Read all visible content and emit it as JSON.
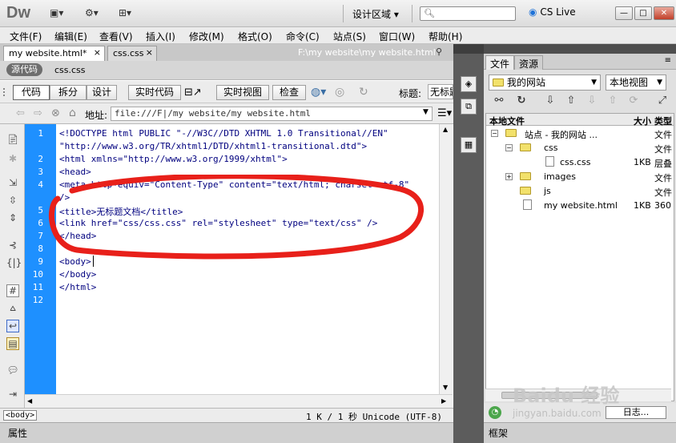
{
  "app": {
    "logo": "Dw",
    "workspace": "设计区域",
    "cslive": "CS Live"
  },
  "window": {
    "minimize": "—",
    "restore": "□",
    "close": "✕"
  },
  "menu": [
    "文件(F)",
    "编辑(E)",
    "查看(V)",
    "插入(I)",
    "修改(M)",
    "格式(O)",
    "命令(C)",
    "站点(S)",
    "窗口(W)",
    "帮助(H)"
  ],
  "tabs": [
    {
      "label": "my website.html*"
    },
    {
      "label": "css.css"
    }
  ],
  "doc_path": "F:\\my website\\my website.html",
  "source_code_label": "源代码",
  "related_file": "css.css",
  "toolbar": {
    "code": "代码",
    "split": "拆分",
    "design": "设计",
    "live_code": "实时代码",
    "live_view": "实时视图",
    "inspect": "检查",
    "title_label": "标题:",
    "title_value": "无标题"
  },
  "address": {
    "label": "地址:",
    "value": "file:///F|/my website/my website.html"
  },
  "code_lines": [
    {
      "num": "1",
      "text": "<!DOCTYPE html PUBLIC \"-//W3C//DTD XHTML 1.0 Transitional//EN\""
    },
    {
      "num": "",
      "text": "\"http://www.w3.org/TR/xhtml1/DTD/xhtml1-transitional.dtd\">"
    },
    {
      "num": "2",
      "text": "<html xmlns=\"http://www.w3.org/1999/xhtml\">"
    },
    {
      "num": "3",
      "text": "<head>"
    },
    {
      "num": "4",
      "text": "<meta http-equiv=\"Content-Type\" content=\"text/html; charset=utf-8\""
    },
    {
      "num": "",
      "text": "/>"
    },
    {
      "num": "5",
      "text": "<title>无标题文档</title>"
    },
    {
      "num": "6",
      "text": "<link href=\"css/css.css\" rel=\"stylesheet\" type=\"text/css\" />"
    },
    {
      "num": "7",
      "text": "</head>"
    },
    {
      "num": "8",
      "text": ""
    },
    {
      "num": "9",
      "text": "<body>"
    },
    {
      "num": "10",
      "text": "</body>"
    },
    {
      "num": "11",
      "text": "</html>"
    },
    {
      "num": "12",
      "text": ""
    }
  ],
  "status": {
    "tag": "<body>",
    "info": "1 K / 1 秒  Unicode (UTF-8)"
  },
  "properties_label": "属性",
  "right_panel": {
    "tab_files": "文件",
    "tab_assets": "资源",
    "site_select": "我的网站",
    "view_select": "本地视图",
    "columns": {
      "name": "本地文件",
      "size": "大小",
      "type": "类型"
    },
    "files": [
      {
        "name": "站点 - 我的网站 ...",
        "size": "",
        "type": "文件",
        "kind": "site",
        "depth": 0,
        "expander": "−"
      },
      {
        "name": "css",
        "size": "",
        "type": "文件",
        "kind": "folder",
        "depth": 1,
        "expander": "−"
      },
      {
        "name": "css.css",
        "size": "1KB",
        "type": "层叠",
        "kind": "file",
        "depth": 2,
        "expander": ""
      },
      {
        "name": "images",
        "size": "",
        "type": "文件",
        "kind": "folder",
        "depth": 1,
        "expander": "+"
      },
      {
        "name": "js",
        "size": "",
        "type": "文件",
        "kind": "folder",
        "depth": 1,
        "expander": ""
      },
      {
        "name": "my website.html",
        "size": "1KB",
        "type": "360",
        "kind": "file",
        "depth": 1,
        "expander": ""
      }
    ],
    "log_button": "日志...",
    "frameset_label": "框架"
  },
  "watermark": "Baidu 经验",
  "watermark_sub": "jingyan.baidu.com",
  "colors": {
    "gutter": "#1e90ff",
    "code_text": "#00007f",
    "annotation": "#e8201a"
  }
}
